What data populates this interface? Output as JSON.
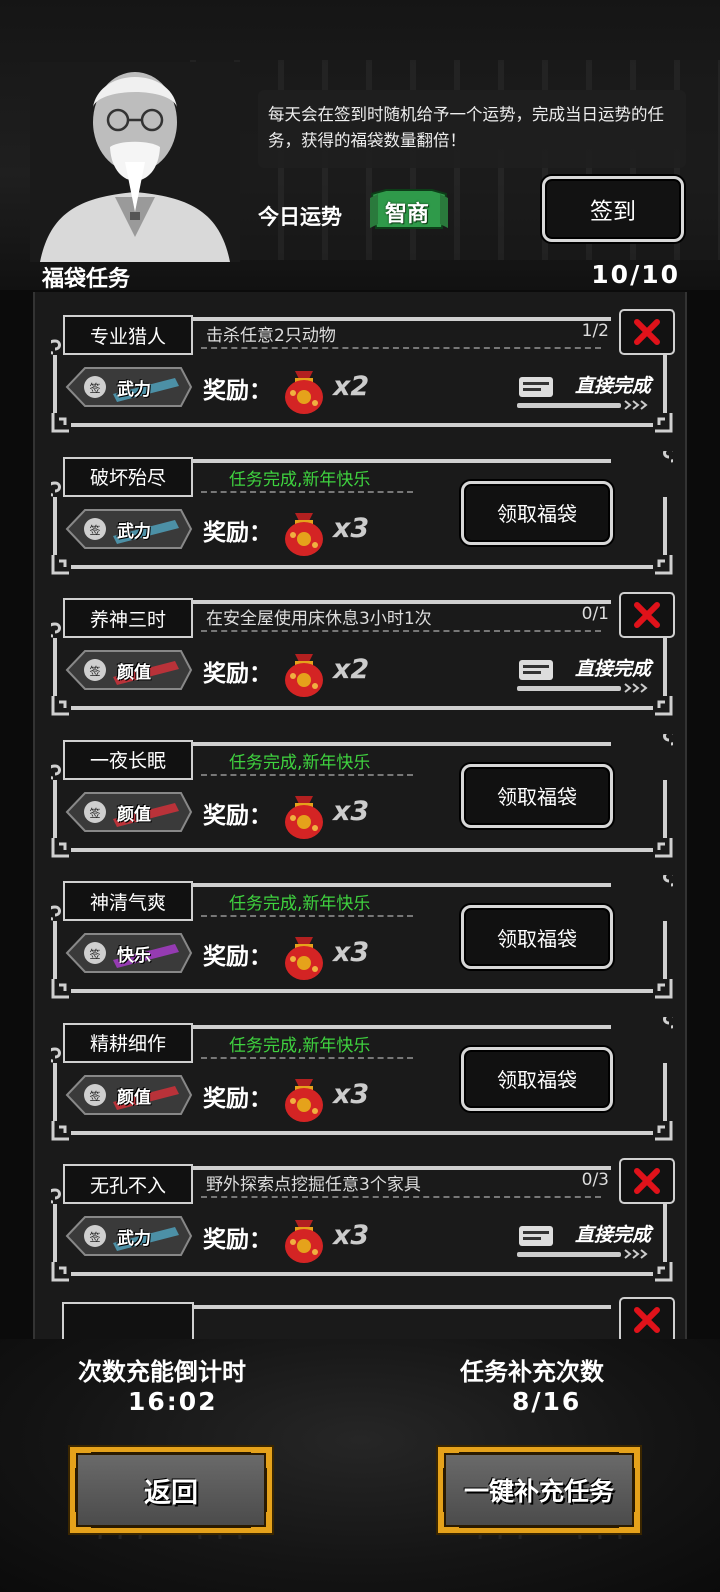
{
  "header": {
    "hint": "每天会在签到时随机给予一个运势，完成当日运势的任务，获得的福袋数量翻倍！",
    "fortune_label": "今日运势",
    "fortune_value": "智商",
    "signin_label": "签到"
  },
  "section": {
    "title": "福袋任务",
    "count": "10/10"
  },
  "tasks": [
    {
      "name": "专业猎人",
      "status": "in_progress",
      "desc": "击杀任意2只动物",
      "progress": "1/2",
      "tag": "武力",
      "tag_color": "#4f9ab3",
      "reward_label": "奖励：",
      "multiplier": "x2",
      "complete_label": "直接完成"
    },
    {
      "name": "破坏殆尽",
      "status": "done",
      "done_text": "任务完成,新年快乐",
      "tag": "武力",
      "tag_color": "#4f9ab3",
      "reward_label": "奖励：",
      "multiplier": "x3",
      "claim_label": "领取福袋"
    },
    {
      "name": "养神三时",
      "status": "in_progress",
      "desc": "在安全屋使用床休息3小时1次",
      "progress": "0/1",
      "tag": "颜值",
      "tag_color": "#c8323a",
      "reward_label": "奖励：",
      "multiplier": "x2",
      "complete_label": "直接完成"
    },
    {
      "name": "一夜长眠",
      "status": "done",
      "done_text": "任务完成,新年快乐",
      "tag": "颜值",
      "tag_color": "#c8323a",
      "reward_label": "奖励：",
      "multiplier": "x3",
      "claim_label": "领取福袋"
    },
    {
      "name": "神清气爽",
      "status": "done",
      "done_text": "任务完成,新年快乐",
      "tag": "快乐",
      "tag_color": "#a03cc0",
      "reward_label": "奖励：",
      "multiplier": "x3",
      "claim_label": "领取福袋"
    },
    {
      "name": "精耕细作",
      "status": "done",
      "done_text": "任务完成,新年快乐",
      "tag": "颜值",
      "tag_color": "#c8323a",
      "reward_label": "奖励：",
      "multiplier": "x3",
      "claim_label": "领取福袋"
    },
    {
      "name": "无孔不入",
      "status": "in_progress",
      "desc": "野外探索点挖掘任意3个家具",
      "progress": "0/3",
      "tag": "武力",
      "tag_color": "#4f9ab3",
      "reward_label": "奖励：",
      "multiplier": "x3",
      "complete_label": "直接完成"
    }
  ],
  "footer": {
    "timer_label": "次数充能倒计时",
    "timer_value": "16:02",
    "refill_label": "任务补充次数",
    "refill_value": "8/16",
    "back_label": "返回",
    "refill_button_label": "一键补充任务"
  },
  "colors": {
    "accent_gold": "#e5a21b",
    "done_green": "#3fd23f",
    "close_red": "#e0121a"
  }
}
